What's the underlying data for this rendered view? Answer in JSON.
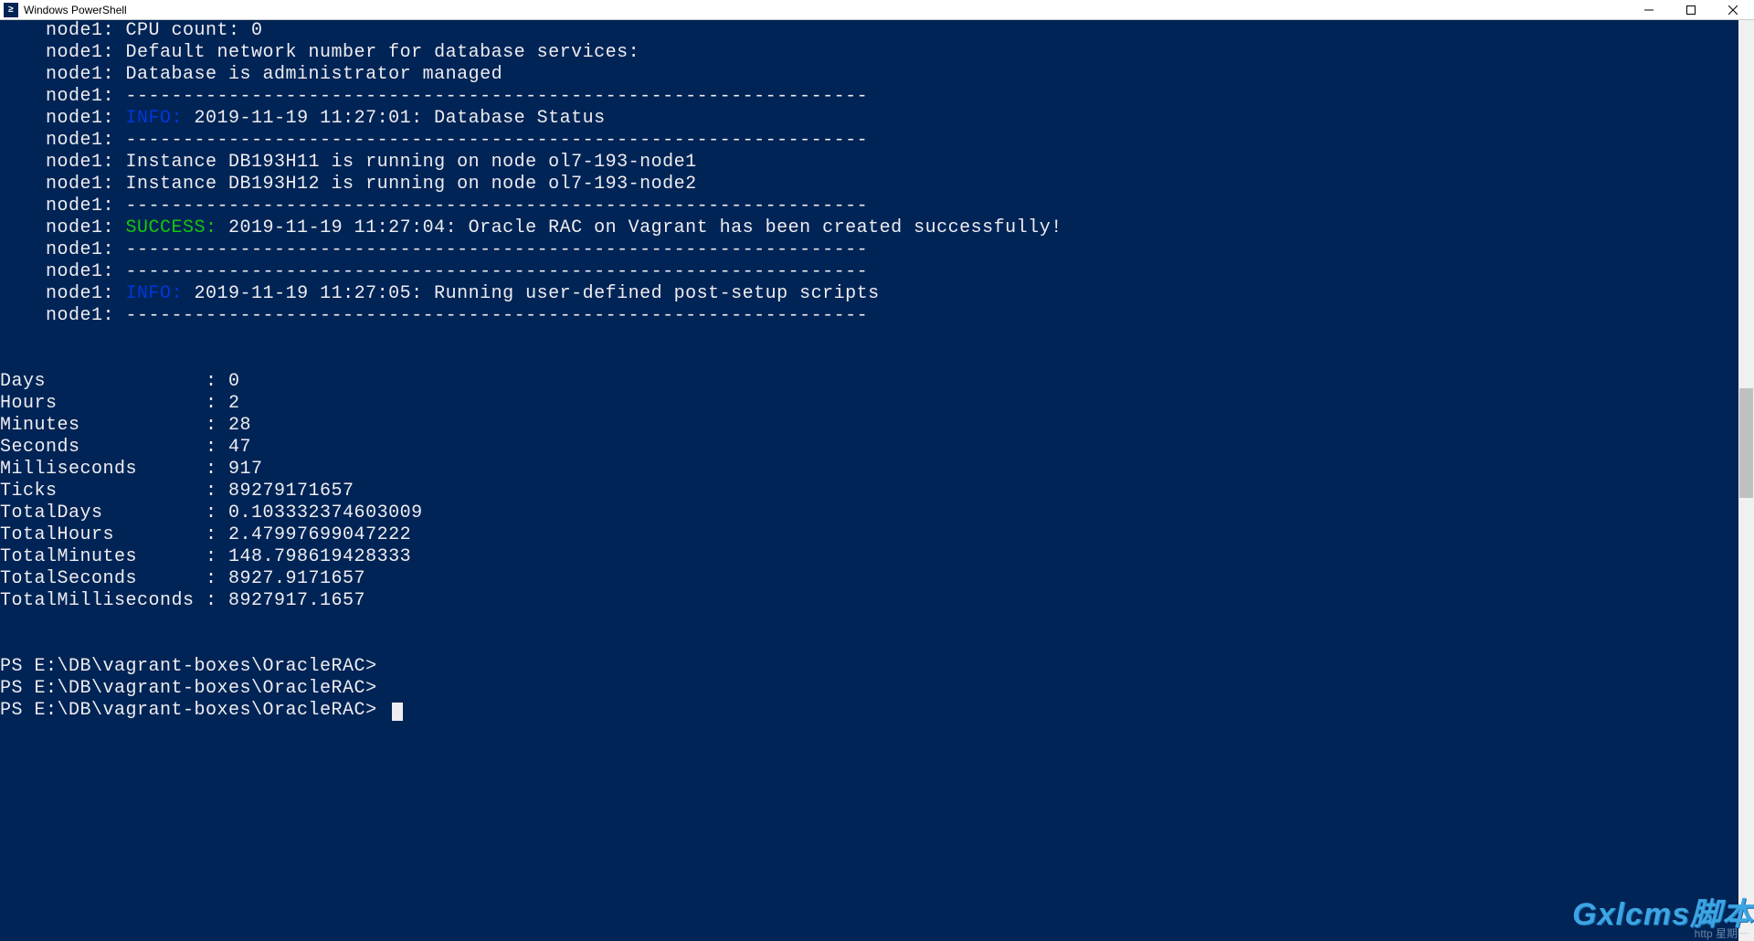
{
  "window": {
    "title": "Windows PowerShell",
    "icon_glyph": "≥"
  },
  "divider": "-----------------------------------------------------------------",
  "terminal": {
    "indent": "    ",
    "prefix": "node1: ",
    "lines": [
      {
        "type": "plain",
        "text": "CPU count: 0"
      },
      {
        "type": "plain",
        "text": "Default network number for database services:"
      },
      {
        "type": "plain",
        "text": "Database is administrator managed"
      },
      {
        "type": "divider"
      },
      {
        "type": "info",
        "label": "INFO:",
        "text": " 2019-11-19 11:27:01: Database Status"
      },
      {
        "type": "divider"
      },
      {
        "type": "plain",
        "text": "Instance DB193H11 is running on node ol7-193-node1"
      },
      {
        "type": "plain",
        "text": "Instance DB193H12 is running on node ol7-193-node2"
      },
      {
        "type": "divider"
      },
      {
        "type": "success",
        "label": "SUCCESS:",
        "text": " 2019-11-19 11:27:04: Oracle RAC on Vagrant has been created successfully!"
      },
      {
        "type": "divider"
      },
      {
        "type": "divider"
      },
      {
        "type": "info",
        "label": "INFO:",
        "text": " 2019-11-19 11:27:05: Running user-defined post-setup scripts"
      },
      {
        "type": "divider"
      }
    ],
    "timing": [
      {
        "key": "Days",
        "value": "0"
      },
      {
        "key": "Hours",
        "value": "2"
      },
      {
        "key": "Minutes",
        "value": "28"
      },
      {
        "key": "Seconds",
        "value": "47"
      },
      {
        "key": "Milliseconds",
        "value": "917"
      },
      {
        "key": "Ticks",
        "value": "89279171657"
      },
      {
        "key": "TotalDays",
        "value": "0.103332374603009"
      },
      {
        "key": "TotalHours",
        "value": "2.47997699047222"
      },
      {
        "key": "TotalMinutes",
        "value": "148.798619428333"
      },
      {
        "key": "TotalSeconds",
        "value": "8927.9171657"
      },
      {
        "key": "TotalMilliseconds",
        "value": "8927917.1657"
      }
    ],
    "prompts": [
      "PS E:\\DB\\vagrant-boxes\\OracleRAC>",
      "PS E:\\DB\\vagrant-boxes\\OracleRAC>",
      "PS E:\\DB\\vagrant-boxes\\OracleRAC>"
    ]
  },
  "watermark": {
    "main": "Gxlcms脚本",
    "sub": "http    星期一"
  }
}
